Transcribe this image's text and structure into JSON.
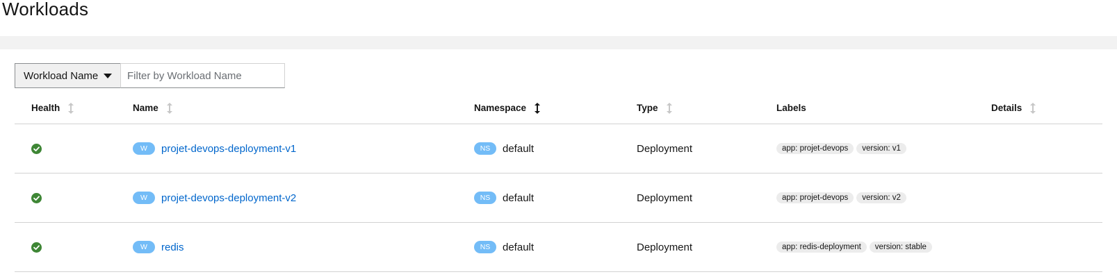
{
  "page": {
    "title": "Workloads"
  },
  "toolbar": {
    "filter_type": "Workload Name",
    "filter_placeholder": "Filter by Workload Name"
  },
  "table": {
    "headers": {
      "health": "Health",
      "name": "Name",
      "namespace": "Namespace",
      "type": "Type",
      "labels": "Labels",
      "details": "Details"
    },
    "active_sort": "namespace",
    "rows": [
      {
        "health": "healthy",
        "badge": "W",
        "name": "projet-devops-deployment-v1",
        "ns_badge": "NS",
        "namespace": "default",
        "type": "Deployment",
        "labels": [
          "app: projet-devops",
          "version: v1"
        ]
      },
      {
        "health": "healthy",
        "badge": "W",
        "name": "projet-devops-deployment-v2",
        "ns_badge": "NS",
        "namespace": "default",
        "type": "Deployment",
        "labels": [
          "app: projet-devops",
          "version: v2"
        ]
      },
      {
        "health": "healthy",
        "badge": "W",
        "name": "redis",
        "ns_badge": "NS",
        "namespace": "default",
        "type": "Deployment",
        "labels": [
          "app: redis-deployment",
          "version: stable"
        ]
      }
    ]
  },
  "colors": {
    "link": "#0066cc",
    "healthy": "#3e8635",
    "badge": "#73bcf7",
    "chip": "#ececec"
  },
  "icons": {
    "health": "check-circle-icon",
    "sort": "sort-icon",
    "dropdown": "caret-down-icon"
  }
}
